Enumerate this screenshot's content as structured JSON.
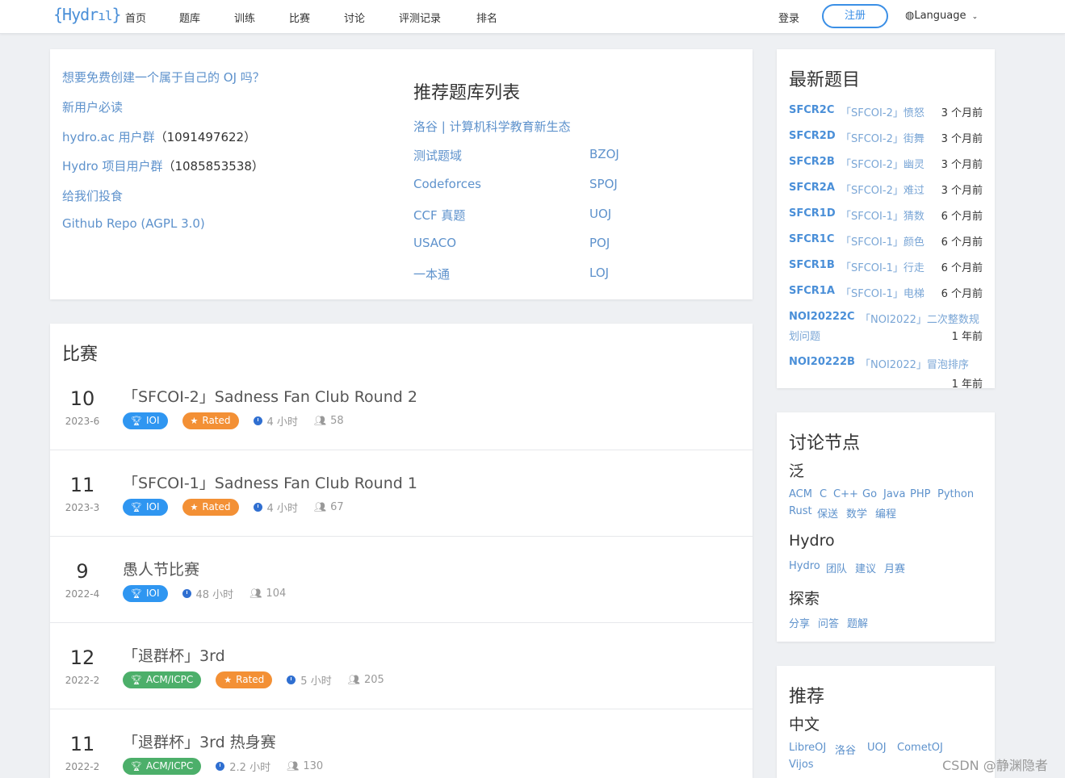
{
  "nav": {
    "logo": "{Hydr",
    "items": [
      "首页",
      "题库",
      "训练",
      "比赛",
      "讨论",
      "评测记录",
      "排名"
    ],
    "login": "登录",
    "register": "注册",
    "language": "Language"
  },
  "intro": {
    "links": [
      {
        "text": "想要免费创建一个属于自己的 OJ 吗？",
        "suffix": ""
      },
      {
        "text": "新用户必读",
        "suffix": ""
      },
      {
        "text": "hydro.ac 用户群",
        "suffix": "（1091497622）"
      },
      {
        "text": "Hydro 项目用户群",
        "suffix": "（1085853538）"
      },
      {
        "text": "给我们投食",
        "suffix": ""
      },
      {
        "text": "Github Repo (AGPL 3.0)",
        "suffix": ""
      }
    ],
    "rec_title": "推荐题库列表",
    "rec_banner": "洛谷 | 计算机科学教育新生态",
    "rec_left": [
      "测试题域",
      "Codeforces",
      "CCF 真题",
      "USACO",
      "一本通"
    ],
    "rec_right": [
      "BZOJ",
      "SPOJ",
      "UOJ",
      "POJ",
      "LOJ"
    ]
  },
  "contests": {
    "title": "比赛",
    "items": [
      {
        "day": "10",
        "month": "2023-6",
        "title": "「SFCOI-2」Sadness Fan Club Round 2",
        "rule": "IOI",
        "rule_type": "ioi",
        "rated": "Rated",
        "duration": "4 小时",
        "attendees": "58"
      },
      {
        "day": "11",
        "month": "2023-3",
        "title": "「SFCOI-1」Sadness Fan Club Round 1",
        "rule": "IOI",
        "rule_type": "ioi",
        "rated": "Rated",
        "duration": "4 小时",
        "attendees": "67"
      },
      {
        "day": "9",
        "month": "2022-4",
        "title": "愚人节比赛",
        "rule": "IOI",
        "rule_type": "ioi",
        "rated": "",
        "duration": "48 小时",
        "attendees": "104"
      },
      {
        "day": "12",
        "month": "2022-2",
        "title": "「退群杯」3rd",
        "rule": "ACM/ICPC",
        "rule_type": "acm",
        "rated": "Rated",
        "duration": "5 小时",
        "attendees": "205"
      },
      {
        "day": "11",
        "month": "2022-2",
        "title": "「退群杯」3rd 热身赛",
        "rule": "ACM/ICPC",
        "rule_type": "acm",
        "rated": "",
        "duration": "2.2 小时",
        "attendees": "130"
      }
    ]
  },
  "latest": {
    "title": "最新题目",
    "items": [
      {
        "pid": "SFCR2C",
        "title": "「SFCOI-2」愤怒",
        "time": "3 个月前"
      },
      {
        "pid": "SFCR2D",
        "title": "「SFCOI-2」街舞",
        "time": "3 个月前"
      },
      {
        "pid": "SFCR2B",
        "title": "「SFCOI-2」幽灵",
        "time": "3 个月前"
      },
      {
        "pid": "SFCR2A",
        "title": "「SFCOI-2」难过",
        "time": "3 个月前"
      },
      {
        "pid": "SFCR1D",
        "title": "「SFCOI-1」猜数",
        "time": "6 个月前"
      },
      {
        "pid": "SFCR1C",
        "title": "「SFCOI-1」颜色",
        "time": "6 个月前"
      },
      {
        "pid": "SFCR1B",
        "title": "「SFCOI-1」行走",
        "time": "6 个月前"
      },
      {
        "pid": "SFCR1A",
        "title": "「SFCOI-1」电梯",
        "time": "6 个月前"
      },
      {
        "pid": "NOI20222C",
        "title": "「NOI2022」二次整数规",
        "title2": "划问题",
        "time": "1 年前"
      },
      {
        "pid": "NOI20222B",
        "title": "「NOI2022」冒泡排序",
        "title2": "",
        "time": "1 年前"
      }
    ]
  },
  "nodes": {
    "title": "讨论节点",
    "groups": [
      {
        "name": "泛",
        "tags": [
          "ACM",
          "C",
          "C++",
          "Go",
          "Java",
          "PHP",
          "Python",
          "Rust",
          "保送",
          "数学",
          "编程"
        ]
      },
      {
        "name": "Hydro",
        "tags": [
          "Hydro",
          "团队",
          "建议",
          "月赛"
        ]
      },
      {
        "name": "探索",
        "tags": [
          "分享",
          "问答",
          "题解"
        ]
      }
    ]
  },
  "recommend": {
    "title": "推荐",
    "sub": "中文",
    "links": [
      "LibreOJ",
      "洛谷",
      "UOJ",
      "CometOJ",
      "Vijos"
    ]
  },
  "watermark": "CSDN @静渊隐者"
}
